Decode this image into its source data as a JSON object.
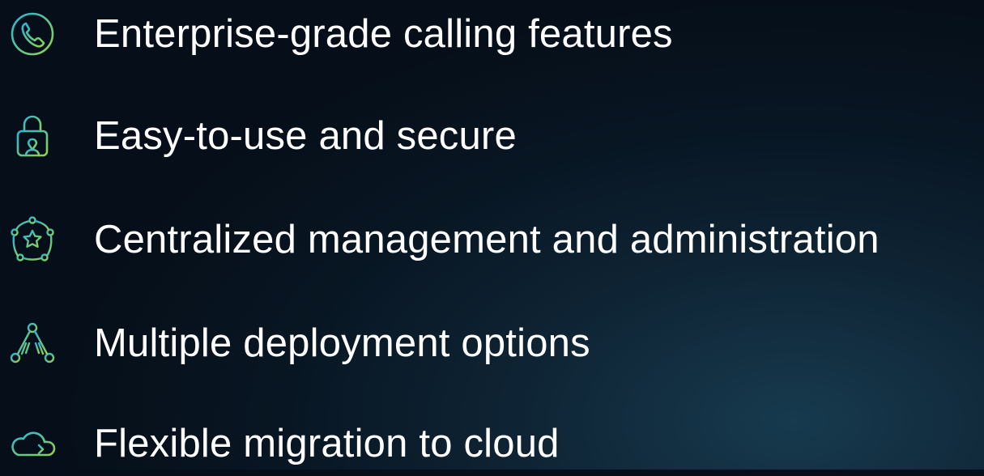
{
  "features": [
    {
      "label": "Enterprise-grade calling features",
      "icon": "phone-icon"
    },
    {
      "label": "Easy-to-use and secure",
      "icon": "lock-icon"
    },
    {
      "label": "Centralized management and administration",
      "icon": "star-network-icon"
    },
    {
      "label": "Multiple deployment options",
      "icon": "network-triangle-icon"
    },
    {
      "label": "Flexible migration to cloud",
      "icon": "cloud-icon"
    }
  ],
  "colors": {
    "icon_gradient_start": "#2bb4d8",
    "icon_gradient_end": "#8fd14f",
    "text": "#ffffff",
    "background": "#081623"
  }
}
